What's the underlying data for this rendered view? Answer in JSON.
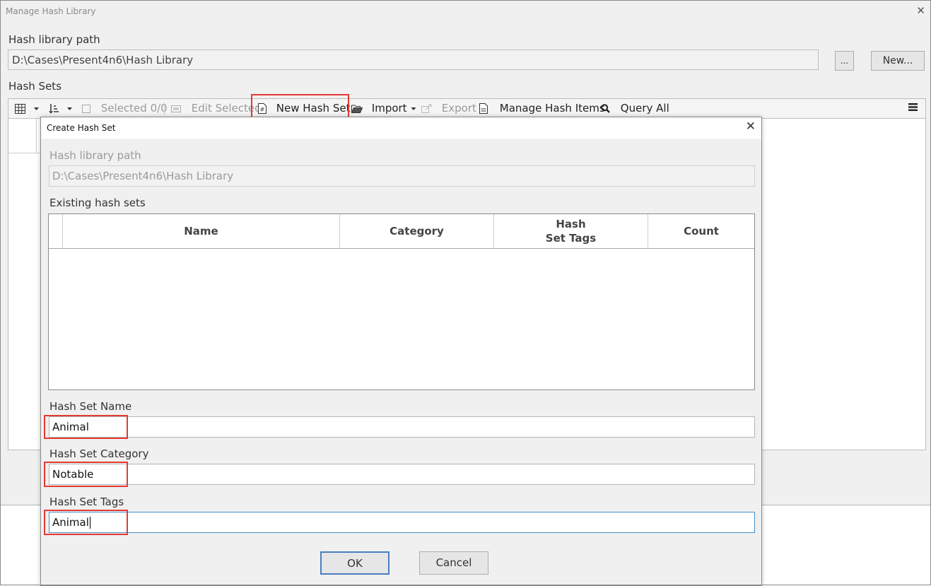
{
  "main_window": {
    "title": "Manage Hash Library",
    "close_glyph": "✕",
    "library_path_label": "Hash library path",
    "library_path_value": "D:\\Cases\\Present4n6\\Hash Library",
    "browse_label": "...",
    "new_label": "New...",
    "hash_sets_label": "Hash Sets",
    "toolbar": {
      "selected_label": "Selected 0/0",
      "edit_selected_label": "Edit Selected",
      "new_hash_set_label": "New Hash Set",
      "import_label": "Import",
      "export_label": "Export",
      "manage_hash_items_label": "Manage Hash Items",
      "query_all_label": "Query All",
      "icons": [
        "grid-icon",
        "sort-icon",
        "checkbox-icon",
        "edit-icon",
        "hash-file-icon",
        "open-folder-icon",
        "export-icon",
        "document-icon",
        "search-icon",
        "hamburger-menu-icon"
      ]
    }
  },
  "dialog": {
    "title": "Create Hash Set",
    "close_glyph": "✕",
    "library_path_label": "Hash library path",
    "library_path_value": "D:\\Cases\\Present4n6\\Hash Library",
    "existing_sets_label": "Existing hash sets",
    "table": {
      "columns": [
        "Name",
        "Category",
        "Hash\nSet Tags",
        "Count"
      ],
      "rows": []
    },
    "name_label": "Hash Set Name",
    "name_value": "Animal",
    "category_label": "Hash Set Category",
    "category_value": "Notable",
    "tags_label": "Hash Set Tags",
    "tags_value": "Animal",
    "ok_label": "OK",
    "cancel_label": "Cancel"
  },
  "colors": {
    "highlight": "#e53935",
    "focus_border": "#4a90c8",
    "window_bg": "#f0f0f0"
  }
}
